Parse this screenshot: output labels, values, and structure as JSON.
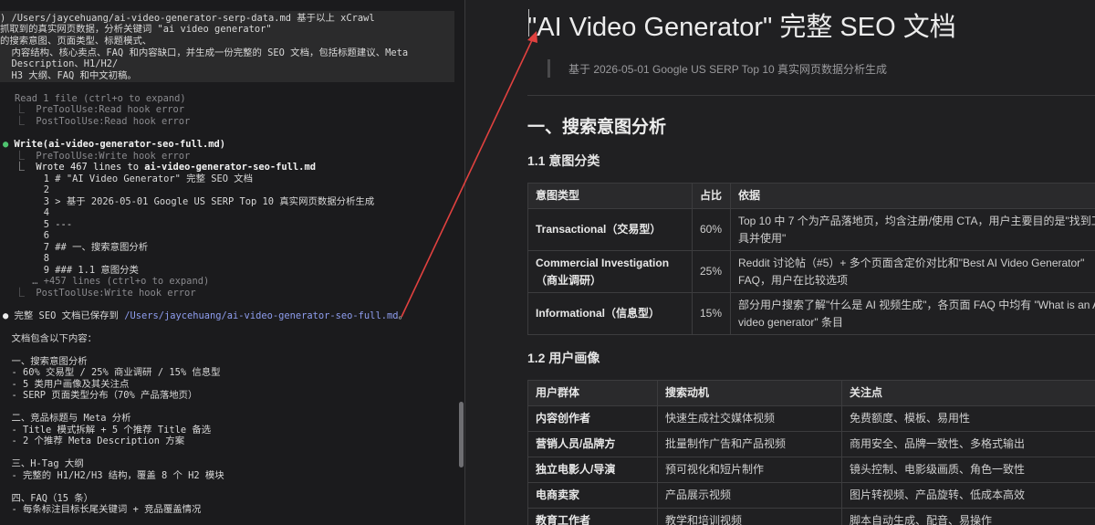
{
  "terminal": {
    "prompt_lines": [
      ") /Users/jaycehuang/ai-video-generator-serp-data.md 基于以上 xCrawl",
      "抓取到的真实网页数据，分析关键词 \"ai video generator\"",
      "的搜索意图、页面类型、标题模式、",
      "  内容结构、核心卖点、FAQ 和内容缺口，并生成一份完整的 SEO 文档，包括标题建议、Meta",
      "  Description、H1/H2/",
      "  H3 大纲、FAQ 和中文初稿。"
    ],
    "read_line": "Read 1 file (ctrl+o to expand)",
    "read_hook1": "  ⎿  PreToolUse:Read hook error",
    "read_hook2": "  ⎿  PostToolUse:Read hook error",
    "write_call": "Write(ai-video-generator-seo-full.md)",
    "write_hook1": "  ⎿  PreToolUse:Write hook error",
    "wrote_prefix": "  ⎿  Wrote 467 lines to ",
    "wrote_file": "ai-video-generator-seo-full.md",
    "file_lines": [
      "       1 # \"AI Video Generator\" 完整 SEO 文档",
      "       2",
      "       3 > 基于 2026-05-01 Google US SERP Top 10 真实网页数据分析生成",
      "       4",
      "       5 ---",
      "       6",
      "       7 ## 一、搜索意图分析",
      "       8",
      "       9 ### 1.1 意图分类"
    ],
    "expand_line": "     … +457 lines (ctrl+o to expand)",
    "write_hook2": "  ⎿  PostToolUse:Write hook error",
    "saved_prefix": " 完整 SEO 文档已保存到 ",
    "saved_path": "/Users/jaycehuang/ai-video-generator-seo-full.md",
    "saved_suffix": "。",
    "summary_lines": [
      "  文档包含以下内容：",
      "",
      "  一、搜索意图分析",
      "  - 60% 交易型 / 25% 商业调研 / 15% 信息型",
      "  - 5 类用户画像及其关注点",
      "  - SERP 页面类型分布（70% 产品落地页）",
      "",
      "  二、竞品标题与 Meta 分析",
      "  - Title 模式拆解 + 5 个推荐 Title 备选",
      "  - 2 个推荐 Meta Description 方案",
      "",
      "  三、H-Tag 大纲",
      "  - 完整的 H1/H2/H3 结构，覆盖 8 个 H2 模块",
      "",
      "  四、FAQ（15 条）",
      "  - 每条标注目标长尾关键词 + 竞品覆盖情况"
    ]
  },
  "doc": {
    "title": "\"AI Video Generator\" 完整 SEO 文档",
    "quote": "基于 2026-05-01 Google US SERP Top 10 真实网页数据分析生成",
    "h2": "一、搜索意图分析",
    "h3_1": "1.1 意图分类",
    "h3_2": "1.2 用户画像",
    "intent_table": {
      "headers": [
        "意图类型",
        "占比",
        "依据"
      ],
      "rows": [
        {
          "type": "Transactional（交易型）",
          "share": "60%",
          "basis": "Top 10 中 7 个为产品落地页，均含注册/使用 CTA，用户主要目的是\"找到工具并使用\""
        },
        {
          "type": "Commercial Investigation（商业调研）",
          "share": "25%",
          "basis": "Reddit 讨论帖（#5）+ 多个页面含定价对比和\"Best AI Video Generator\" FAQ，用户在比较选项"
        },
        {
          "type": "Informational（信息型）",
          "share": "15%",
          "basis": "部分用户搜索了解\"什么是 AI 视频生成\"，各页面 FAQ 中均有 \"What is an AI video generator\" 条目"
        }
      ]
    },
    "persona_table": {
      "headers": [
        "用户群体",
        "搜索动机",
        "关注点"
      ],
      "rows": [
        {
          "group": "内容创作者",
          "motive": "快速生成社交媒体视频",
          "focus": "免费额度、模板、易用性"
        },
        {
          "group": "营销人员/品牌方",
          "motive": "批量制作广告和产品视频",
          "focus": "商用安全、品牌一致性、多格式输出"
        },
        {
          "group": "独立电影人/导演",
          "motive": "预可视化和短片制作",
          "focus": "镜头控制、电影级画质、角色一致性"
        },
        {
          "group": "电商卖家",
          "motive": "产品展示视频",
          "focus": "图片转视频、产品旋转、低成本高效"
        },
        {
          "group": "教育工作者",
          "motive": "教学和培训视频",
          "focus": "脚本自动生成、配音、易操作"
        }
      ]
    }
  },
  "colors": {
    "accent_red": "#e0413f",
    "bullet_green": "#4ec36f",
    "path_blue": "#8f9ef0"
  }
}
